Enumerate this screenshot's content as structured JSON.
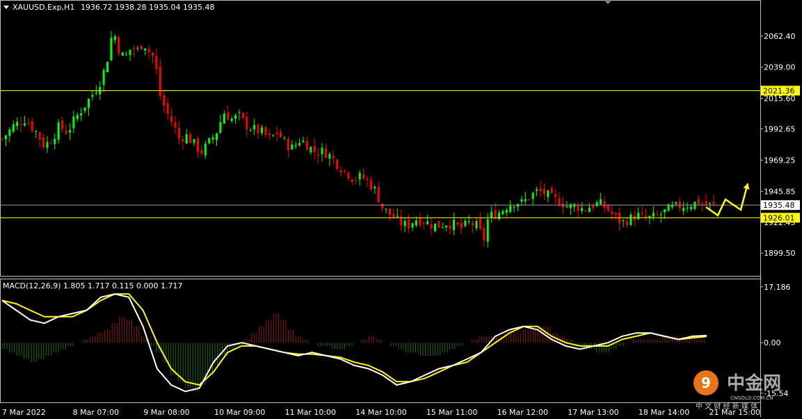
{
  "chart_data": [
    {
      "type": "candlestick",
      "symbol_label": "XAUUSD.Exp,H1",
      "ohlc_label": "1936.72 1938.28 1935.04 1935.48",
      "ylim": [
        1885,
        2080
      ],
      "y_ticks": [
        "2062.40",
        "2039.00",
        "2015.60",
        "1992.65",
        "1969.25",
        "1945.85",
        "1922.45",
        "1899.50"
      ],
      "current_price": "1935.48",
      "levels": [
        {
          "label": "2021.36",
          "value": 2021.36
        },
        {
          "label": "1926.01",
          "value": 1926.01
        }
      ],
      "x_labels": [
        "7 Mar 2022",
        "8 Mar 07:00",
        "9 Mar 08:00",
        "10 Mar 09:00",
        "11 Mar 10:00",
        "14 Mar 10:00",
        "15 Mar 11:00",
        "16 Mar 12:00",
        "17 Mar 13:00",
        "18 Mar 14:00",
        "21 Mar 15:00"
      ],
      "close_path": [
        [
          0,
          1985
        ],
        [
          3,
          1995
        ],
        [
          6,
          2000
        ],
        [
          9,
          1990
        ],
        [
          11,
          1980
        ],
        [
          13,
          1985
        ],
        [
          15,
          1995
        ],
        [
          17,
          1990
        ],
        [
          19,
          2000
        ],
        [
          22,
          2012
        ],
        [
          24,
          2020
        ],
        [
          26,
          2030
        ],
        [
          28,
          2050
        ],
        [
          29,
          2070
        ],
        [
          30,
          2055
        ],
        [
          32,
          2045
        ],
        [
          34,
          2055
        ],
        [
          35,
          2050
        ],
        [
          37,
          2058
        ],
        [
          38,
          2052
        ],
        [
          40,
          2045
        ],
        [
          41,
          2020
        ],
        [
          43,
          2005
        ],
        [
          45,
          1995
        ],
        [
          46,
          1985
        ],
        [
          48,
          1988
        ],
        [
          50,
          1982
        ],
        [
          52,
          1975
        ],
        [
          54,
          1982
        ],
        [
          56,
          1990
        ],
        [
          58,
          2005
        ],
        [
          60,
          2000
        ],
        [
          62,
          2002
        ],
        [
          64,
          1995
        ],
        [
          66,
          1992
        ],
        [
          68,
          1990
        ],
        [
          70,
          1985
        ],
        [
          72,
          1990
        ],
        [
          74,
          1982
        ],
        [
          76,
          1978
        ],
        [
          78,
          1985
        ],
        [
          80,
          1980
        ],
        [
          82,
          1975
        ],
        [
          84,
          1976
        ],
        [
          86,
          1972
        ],
        [
          88,
          1965
        ],
        [
          90,
          1960
        ],
        [
          92,
          1955
        ],
        [
          94,
          1957
        ],
        [
          96,
          1952
        ],
        [
          98,
          1945
        ],
        [
          99,
          1935
        ],
        [
          100,
          1932
        ],
        [
          102,
          1927
        ],
        [
          104,
          1922
        ],
        [
          106,
          1920
        ],
        [
          108,
          1925
        ],
        [
          110,
          1924
        ],
        [
          112,
          1921
        ],
        [
          114,
          1920
        ],
        [
          116,
          1922
        ],
        [
          118,
          1921
        ],
        [
          120,
          1918
        ],
        [
          122,
          1922
        ],
        [
          124,
          1920
        ],
        [
          126,
          1910
        ],
        [
          127,
          1925
        ],
        [
          128,
          1928
        ],
        [
          130,
          1930
        ],
        [
          132,
          1935
        ],
        [
          134,
          1938
        ],
        [
          136,
          1937
        ],
        [
          138,
          1942
        ],
        [
          140,
          1946
        ],
        [
          142,
          1944
        ],
        [
          144,
          1940
        ],
        [
          146,
          1938
        ],
        [
          148,
          1934
        ],
        [
          150,
          1935
        ],
        [
          152,
          1932
        ],
        [
          154,
          1935
        ],
        [
          156,
          1937
        ],
        [
          158,
          1933
        ],
        [
          160,
          1927
        ],
        [
          162,
          1922
        ],
        [
          164,
          1925
        ],
        [
          166,
          1928
        ],
        [
          168,
          1925
        ],
        [
          170,
          1926
        ],
        [
          172,
          1928
        ],
        [
          174,
          1932
        ],
        [
          176,
          1934
        ],
        [
          178,
          1935
        ],
        [
          180,
          1936
        ],
        [
          182,
          1938
        ],
        [
          184,
          1936
        ],
        [
          186,
          1935
        ]
      ],
      "forecast_arrows": [
        [
          1015,
          298,
          1032,
          310,
          1043,
          287,
          1065,
          302,
          1075,
          264
        ]
      ]
    },
    {
      "type": "macd",
      "label": "MACD(12,26,9) 1.805 1.717 0.115 0.000 1.717",
      "ylim": [
        -17.5,
        17.8
      ],
      "y_ticks": [
        "17.186",
        "0.00",
        "-15.54"
      ],
      "histogram": [
        -2,
        -3,
        -4,
        -5,
        -6,
        -5,
        -4,
        -3,
        -2,
        -1,
        0,
        1,
        2,
        3,
        4,
        6,
        8,
        7,
        5,
        2,
        -1,
        -3,
        -6,
        -10,
        -12,
        -14,
        -15,
        -13,
        -10,
        -7,
        -4,
        -2,
        -1,
        1,
        3,
        5,
        7,
        9,
        7,
        4,
        2,
        1,
        0,
        -1,
        -1,
        -2,
        -2,
        -1,
        0,
        1,
        2,
        1,
        0,
        -1,
        -2,
        -3,
        -3,
        -4,
        -4,
        -4,
        -3,
        -2,
        -1,
        0,
        1,
        2,
        2,
        2,
        2,
        3,
        3,
        4,
        4,
        5,
        5,
        3,
        2,
        1,
        -1,
        -2,
        -2,
        -3,
        -3,
        -2,
        -1,
        0,
        1,
        1,
        1,
        1,
        2,
        2,
        2,
        1,
        1,
        1,
        0
      ],
      "macd_line": [
        [
          0,
          13
        ],
        [
          10,
          10
        ],
        [
          20,
          7
        ],
        [
          30,
          6
        ],
        [
          40,
          8
        ],
        [
          50,
          9
        ],
        [
          60,
          10
        ],
        [
          70,
          14
        ],
        [
          80,
          15
        ],
        [
          90,
          14
        ],
        [
          100,
          5
        ],
        [
          110,
          -8
        ],
        [
          120,
          -13
        ],
        [
          130,
          -15
        ],
        [
          140,
          -14
        ],
        [
          150,
          -6
        ],
        [
          160,
          -1
        ],
        [
          170,
          0
        ],
        [
          180,
          -1
        ],
        [
          190,
          -2
        ],
        [
          200,
          -3
        ],
        [
          210,
          -4
        ],
        [
          220,
          -3
        ],
        [
          230,
          -4
        ],
        [
          240,
          -5
        ],
        [
          250,
          -7
        ],
        [
          260,
          -8
        ],
        [
          270,
          -10
        ],
        [
          280,
          -13
        ],
        [
          290,
          -12
        ],
        [
          300,
          -10
        ],
        [
          310,
          -8
        ],
        [
          320,
          -7
        ],
        [
          330,
          -5
        ],
        [
          340,
          -3
        ],
        [
          350,
          2
        ],
        [
          360,
          4
        ],
        [
          370,
          5
        ],
        [
          380,
          4
        ],
        [
          390,
          1
        ],
        [
          400,
          -1
        ],
        [
          410,
          -2
        ],
        [
          420,
          -1
        ],
        [
          430,
          0
        ],
        [
          440,
          2
        ],
        [
          450,
          3
        ],
        [
          460,
          3
        ],
        [
          470,
          2
        ],
        [
          480,
          1
        ],
        [
          490,
          2
        ],
        [
          500,
          2.2
        ]
      ],
      "signal_line": [
        [
          0,
          13
        ],
        [
          10,
          12
        ],
        [
          20,
          10
        ],
        [
          30,
          8
        ],
        [
          40,
          8
        ],
        [
          50,
          8
        ],
        [
          60,
          10
        ],
        [
          70,
          13
        ],
        [
          80,
          15
        ],
        [
          90,
          15
        ],
        [
          100,
          10
        ],
        [
          110,
          0
        ],
        [
          120,
          -8
        ],
        [
          130,
          -12
        ],
        [
          140,
          -13
        ],
        [
          150,
          -9
        ],
        [
          160,
          -3
        ],
        [
          170,
          -1
        ],
        [
          180,
          -1
        ],
        [
          190,
          -2
        ],
        [
          200,
          -3
        ],
        [
          210,
          -3.5
        ],
        [
          220,
          -3.5
        ],
        [
          230,
          -4
        ],
        [
          240,
          -4.5
        ],
        [
          250,
          -6
        ],
        [
          260,
          -7
        ],
        [
          270,
          -9
        ],
        [
          280,
          -12
        ],
        [
          290,
          -12
        ],
        [
          300,
          -11
        ],
        [
          310,
          -9
        ],
        [
          320,
          -7
        ],
        [
          330,
          -6
        ],
        [
          340,
          -3
        ],
        [
          350,
          0
        ],
        [
          360,
          3
        ],
        [
          370,
          5
        ],
        [
          380,
          5
        ],
        [
          390,
          2
        ],
        [
          400,
          0
        ],
        [
          410,
          -1
        ],
        [
          420,
          -1
        ],
        [
          430,
          -1
        ],
        [
          440,
          1
        ],
        [
          450,
          2
        ],
        [
          460,
          3
        ],
        [
          470,
          2
        ],
        [
          480,
          1
        ],
        [
          490,
          1.5
        ],
        [
          500,
          1.9
        ]
      ]
    }
  ],
  "watermark": {
    "brand": "中金网",
    "domain": "CNGOLD.COM.CN",
    "tagline": "中 文 财 经 新 媒 体",
    "logo_glyph": "9"
  },
  "colors": {
    "bull": "#00ff00",
    "bear": "#ff0000",
    "level": "#ffff00",
    "axis": "#ffffff",
    "macd_pos": "#8b1a1a",
    "macd_neg": "#1b6b1b",
    "macd_line": "#ffffff",
    "signal_line": "#ffff00"
  }
}
